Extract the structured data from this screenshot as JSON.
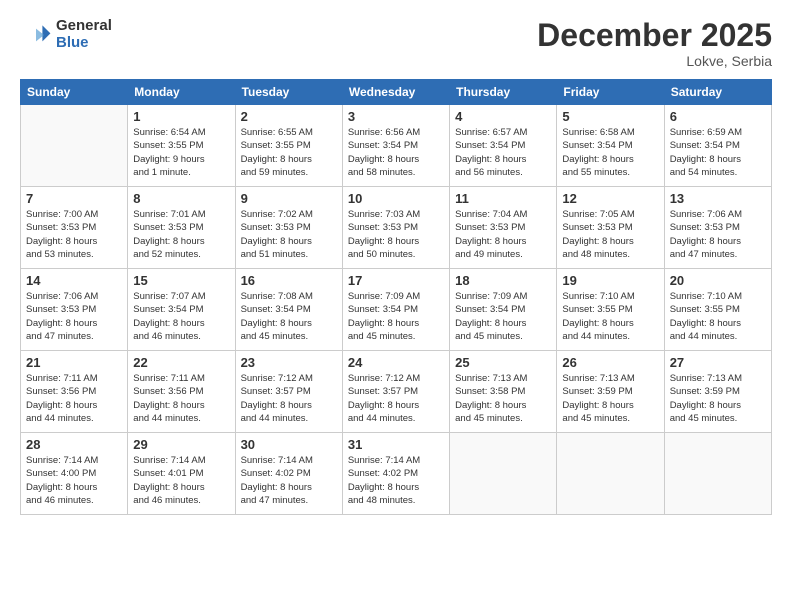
{
  "header": {
    "logo_general": "General",
    "logo_blue": "Blue",
    "month_year": "December 2025",
    "location": "Lokve, Serbia"
  },
  "days_of_week": [
    "Sunday",
    "Monday",
    "Tuesday",
    "Wednesday",
    "Thursday",
    "Friday",
    "Saturday"
  ],
  "weeks": [
    [
      {
        "day": "",
        "info": ""
      },
      {
        "day": "1",
        "info": "Sunrise: 6:54 AM\nSunset: 3:55 PM\nDaylight: 9 hours\nand 1 minute."
      },
      {
        "day": "2",
        "info": "Sunrise: 6:55 AM\nSunset: 3:55 PM\nDaylight: 8 hours\nand 59 minutes."
      },
      {
        "day": "3",
        "info": "Sunrise: 6:56 AM\nSunset: 3:54 PM\nDaylight: 8 hours\nand 58 minutes."
      },
      {
        "day": "4",
        "info": "Sunrise: 6:57 AM\nSunset: 3:54 PM\nDaylight: 8 hours\nand 56 minutes."
      },
      {
        "day": "5",
        "info": "Sunrise: 6:58 AM\nSunset: 3:54 PM\nDaylight: 8 hours\nand 55 minutes."
      },
      {
        "day": "6",
        "info": "Sunrise: 6:59 AM\nSunset: 3:54 PM\nDaylight: 8 hours\nand 54 minutes."
      }
    ],
    [
      {
        "day": "7",
        "info": ""
      },
      {
        "day": "8",
        "info": "Sunrise: 7:01 AM\nSunset: 3:53 PM\nDaylight: 8 hours\nand 52 minutes."
      },
      {
        "day": "9",
        "info": "Sunrise: 7:02 AM\nSunset: 3:53 PM\nDaylight: 8 hours\nand 51 minutes."
      },
      {
        "day": "10",
        "info": "Sunrise: 7:03 AM\nSunset: 3:53 PM\nDaylight: 8 hours\nand 50 minutes."
      },
      {
        "day": "11",
        "info": "Sunrise: 7:04 AM\nSunset: 3:53 PM\nDaylight: 8 hours\nand 49 minutes."
      },
      {
        "day": "12",
        "info": "Sunrise: 7:05 AM\nSunset: 3:53 PM\nDaylight: 8 hours\nand 48 minutes."
      },
      {
        "day": "13",
        "info": "Sunrise: 7:06 AM\nSunset: 3:53 PM\nDaylight: 8 hours\nand 47 minutes."
      }
    ],
    [
      {
        "day": "14",
        "info": ""
      },
      {
        "day": "15",
        "info": "Sunrise: 7:07 AM\nSunset: 3:54 PM\nDaylight: 8 hours\nand 46 minutes."
      },
      {
        "day": "16",
        "info": "Sunrise: 7:08 AM\nSunset: 3:54 PM\nDaylight: 8 hours\nand 45 minutes."
      },
      {
        "day": "17",
        "info": "Sunrise: 7:09 AM\nSunset: 3:54 PM\nDaylight: 8 hours\nand 45 minutes."
      },
      {
        "day": "18",
        "info": "Sunrise: 7:09 AM\nSunset: 3:54 PM\nDaylight: 8 hours\nand 45 minutes."
      },
      {
        "day": "19",
        "info": "Sunrise: 7:10 AM\nSunset: 3:55 PM\nDaylight: 8 hours\nand 44 minutes."
      },
      {
        "day": "20",
        "info": "Sunrise: 7:10 AM\nSunset: 3:55 PM\nDaylight: 8 hours\nand 44 minutes."
      }
    ],
    [
      {
        "day": "21",
        "info": ""
      },
      {
        "day": "22",
        "info": "Sunrise: 7:11 AM\nSunset: 3:56 PM\nDaylight: 8 hours\nand 44 minutes."
      },
      {
        "day": "23",
        "info": "Sunrise: 7:12 AM\nSunset: 3:57 PM\nDaylight: 8 hours\nand 44 minutes."
      },
      {
        "day": "24",
        "info": "Sunrise: 7:12 AM\nSunset: 3:57 PM\nDaylight: 8 hours\nand 44 minutes."
      },
      {
        "day": "25",
        "info": "Sunrise: 7:13 AM\nSunset: 3:58 PM\nDaylight: 8 hours\nand 45 minutes."
      },
      {
        "day": "26",
        "info": "Sunrise: 7:13 AM\nSunset: 3:59 PM\nDaylight: 8 hours\nand 45 minutes."
      },
      {
        "day": "27",
        "info": "Sunrise: 7:13 AM\nSunset: 3:59 PM\nDaylight: 8 hours\nand 45 minutes."
      }
    ],
    [
      {
        "day": "28",
        "info": "Sunrise: 7:14 AM\nSunset: 4:00 PM\nDaylight: 8 hours\nand 46 minutes."
      },
      {
        "day": "29",
        "info": "Sunrise: 7:14 AM\nSunset: 4:01 PM\nDaylight: 8 hours\nand 46 minutes."
      },
      {
        "day": "30",
        "info": "Sunrise: 7:14 AM\nSunset: 4:02 PM\nDaylight: 8 hours\nand 47 minutes."
      },
      {
        "day": "31",
        "info": "Sunrise: 7:14 AM\nSunset: 4:02 PM\nDaylight: 8 hours\nand 48 minutes."
      },
      {
        "day": "",
        "info": ""
      },
      {
        "day": "",
        "info": ""
      },
      {
        "day": "",
        "info": ""
      }
    ]
  ],
  "week2_sunday": "Sunrise: 7:00 AM\nSunset: 3:53 PM\nDaylight: 8 hours\nand 53 minutes.",
  "week3_sunday": "Sunrise: 7:06 AM\nSunset: 3:53 PM\nDaylight: 8 hours\nand 47 minutes.",
  "week4_sunday": "Sunrise: 7:11 AM\nSunset: 3:56 PM\nDaylight: 8 hours\nand 44 minutes."
}
